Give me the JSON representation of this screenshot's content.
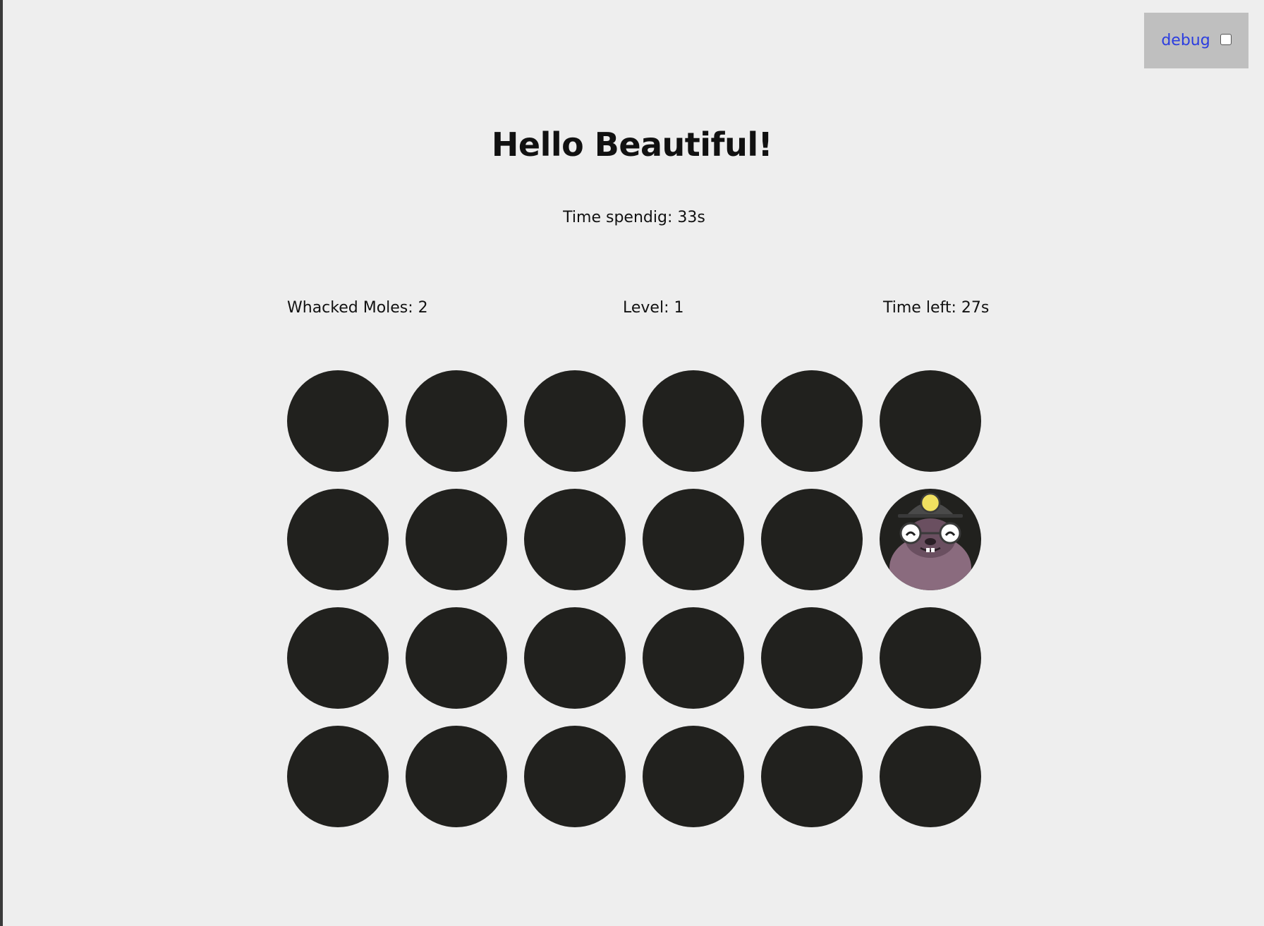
{
  "debug": {
    "label": "debug",
    "checked": false
  },
  "title": "Hello Beautiful!",
  "time_spending": "Time spendig: 33s",
  "stats": {
    "whacked": "Whacked Moles: 2",
    "level": "Level: 1",
    "time_left": "Time left: 27s"
  },
  "board": {
    "rows": 4,
    "columns": 6,
    "mole_hole_index": 11
  },
  "colors": {
    "background": "#eeeeee",
    "hole": "#21211e",
    "mole_body": "#8a6b7e",
    "helmet": "#4a4a4a",
    "helmet_light": "#f0e060",
    "debug_panel": "#bfbfbf",
    "debug_text": "#2b3de0"
  }
}
